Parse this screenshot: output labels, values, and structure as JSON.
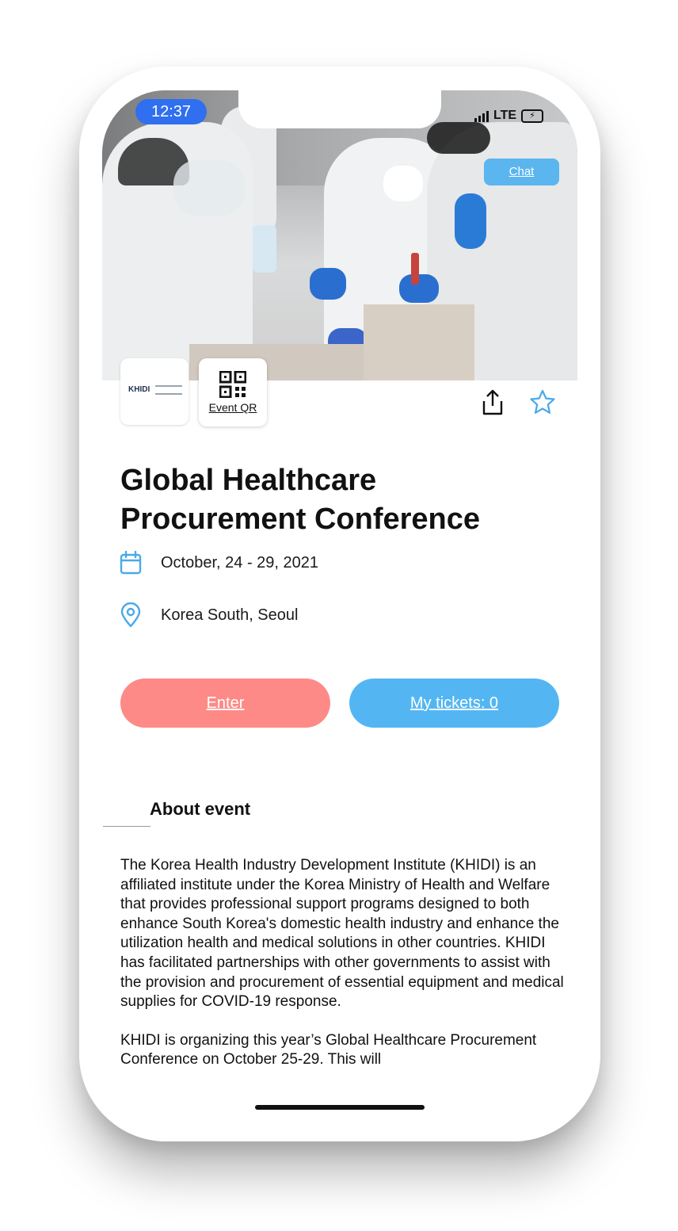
{
  "status_bar": {
    "time": "12:37",
    "network": "LTE"
  },
  "hero": {
    "chat_label": "Chat"
  },
  "organizer_logo": {
    "name": "KHIDI"
  },
  "event_qr": {
    "label": "Event QR"
  },
  "event": {
    "title": "Global Healthcare Procurement Conference",
    "date": "October, 24 - 29, 2021",
    "location": "Korea South, Seoul"
  },
  "actions": {
    "enter_label": "Enter",
    "tickets_label": "My tickets: 0"
  },
  "about": {
    "heading": "About event",
    "paragraphs": [
      "The Korea Health Industry Development Institute (KHIDI) is an affiliated institute under the Korea Ministry of Health and Welfare that provides professional support programs designed to both enhance South Korea's domestic health industry and enhance the utilization health and medical solutions in other countries. KHIDI has facilitated partnerships with other governments to assist with the provision and procurement of essential equipment and medical supplies for COVID-19 response.",
      "KHIDI is organizing this year’s Global Healthcare Procurement Conference on October 25-29. This will"
    ]
  },
  "colors": {
    "time_pill": "#2f6ff0",
    "chat_button": "#5bb5ee",
    "enter_button": "#fd8a87",
    "tickets_button": "#53b6f2",
    "icon_blue": "#4aa9ea"
  },
  "icons": [
    "calendar-icon",
    "location-pin-icon",
    "share-icon",
    "star-icon",
    "qr-code-icon"
  ]
}
